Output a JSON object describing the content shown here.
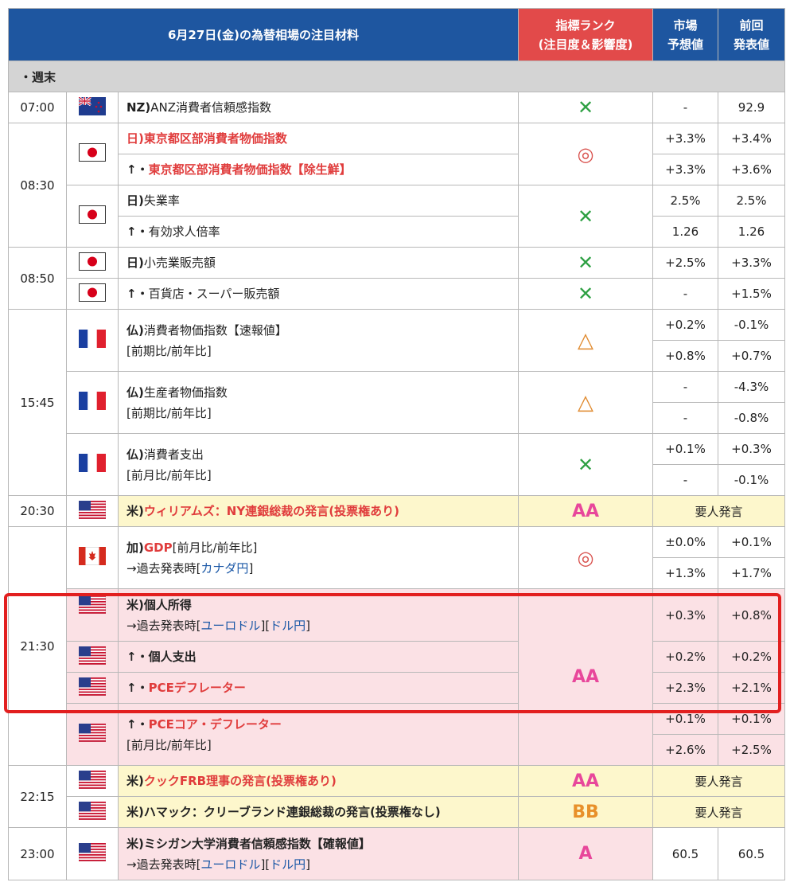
{
  "header": {
    "title": "6月27日(金)の為替相場の注目材料",
    "rank_line1": "指標ランク",
    "rank_line2": "(注目度＆影響度)",
    "forecast_line1": "市場",
    "forecast_line2": "予想値",
    "previous_line1": "前回",
    "previous_line2": "発表値"
  },
  "section": "・週末",
  "rows": {
    "r1": {
      "time": "07:00",
      "country": "NZ)",
      "name": "ANZ消費者信頼感指数",
      "rank": "✕",
      "forecast": "-",
      "previous": "92.9"
    },
    "r2": {
      "time": "08:30",
      "country": "日)",
      "name": "東京都区部消費者物価指数",
      "rank": "◎",
      "forecast": "+3.3%",
      "previous": "+3.4%"
    },
    "r3": {
      "prefix": "↑・",
      "name": "東京都区部消費者物価指数【除生鮮】",
      "forecast": "+3.3%",
      "previous": "+3.6%"
    },
    "r4": {
      "country": "日)",
      "name": "失業率",
      "rank": "✕",
      "forecast": "2.5%",
      "previous": "2.5%"
    },
    "r5": {
      "prefix": "↑・",
      "name": "有効求人倍率",
      "forecast": "1.26",
      "previous": "1.26"
    },
    "r6": {
      "time": "08:50",
      "country": "日)",
      "name": "小売業販売額",
      "rank": "✕",
      "forecast": "+2.5%",
      "previous": "+3.3%"
    },
    "r7": {
      "prefix": "↑・",
      "name": "百貨店・スーパー販売額",
      "rank": "✕",
      "forecast": "-",
      "previous": "+1.5%"
    },
    "r8": {
      "time": "15:45",
      "country": "仏)",
      "name": "消費者物価指数【速報値】",
      "sub": "[前期比/前年比]",
      "rank": "△",
      "forecast_a": "+0.2%",
      "previous_a": "-0.1%",
      "forecast_b": "+0.8%",
      "previous_b": "+0.7%"
    },
    "r9": {
      "country": "仏)",
      "name": "生産者物価指数",
      "sub": "[前期比/前年比]",
      "rank": "△",
      "forecast_a": "-",
      "previous_a": "-4.3%",
      "forecast_b": "-",
      "previous_b": "-0.8%"
    },
    "r10": {
      "country": "仏)",
      "name": "消費者支出",
      "sub": "[前月比/前年比]",
      "rank": "✕",
      "forecast_a": "+0.1%",
      "previous_a": "+0.3%",
      "forecast_b": "-",
      "previous_b": "-0.1%"
    },
    "r11": {
      "time": "20:30",
      "country": "米)",
      "name": "ウィリアムズ：NY連銀総裁の発言(投票権あり)",
      "rank": "AA",
      "speech": "要人発言"
    },
    "r12": {
      "country": "加)",
      "name": "GDP",
      "sub1": "[前月比/前年比]",
      "past_prefix": "→過去発表時[",
      "link1": "カナダ円",
      "past_suffix": "]",
      "rank": "◎",
      "forecast_a": "±0.0%",
      "previous_a": "+0.1%",
      "forecast_b": "+1.3%",
      "previous_b": "+1.7%"
    },
    "r13": {
      "time": "21:30",
      "country": "米)",
      "name": "個人所得",
      "past_prefix": "→過去発表時[",
      "link1": "ユーロドル",
      "link_mid": "][",
      "link2": "ドル円",
      "past_suffix": "]",
      "rank": "AA",
      "forecast": "+0.3%",
      "previous": "+0.8%"
    },
    "r14": {
      "prefix": "↑・",
      "name": "個人支出",
      "forecast": "+0.2%",
      "previous": "+0.2%"
    },
    "r15": {
      "prefix": "↑・",
      "name": "PCEデフレーター",
      "forecast": "+2.3%",
      "previous": "+2.1%"
    },
    "r16": {
      "prefix": "↑・",
      "name": "PCEコア・デフレーター",
      "sub": "[前月比/前年比]",
      "forecast_a": "+0.1%",
      "previous_a": "+0.1%",
      "forecast_b": "+2.6%",
      "previous_b": "+2.5%"
    },
    "r17": {
      "time": "22:15",
      "country": "米)",
      "name": "クックFRB理事の発言(投票権あり)",
      "rank": "AA",
      "speech": "要人発言"
    },
    "r18": {
      "country": "米)",
      "name": "ハマック：クリーブランド連銀総裁の発言(投票権なし)",
      "rank": "BB",
      "speech": "要人発言"
    },
    "r19": {
      "time": "23:00",
      "country": "米)",
      "name": "ミシガン大学消費者信頼感指数【確報値】",
      "past_prefix": "→過去発表時[",
      "link1": "ユーロドル",
      "link_mid": "][",
      "link2": "ドル円",
      "past_suffix": "]",
      "rank": "A",
      "forecast": "60.5",
      "previous": "60.5"
    }
  },
  "flags": {
    "nz": "nz-flag-icon",
    "jp": "japan-flag-icon",
    "fr": "france-flag-icon",
    "us": "us-flag-icon",
    "ca": "canada-flag-icon"
  },
  "colors": {
    "header_blue": "#1e56a0",
    "header_red": "#e24a4a",
    "highlight_border": "#e21f1f",
    "pink_row": "#fbe1e5",
    "yellow_row": "#fdf7cc"
  }
}
